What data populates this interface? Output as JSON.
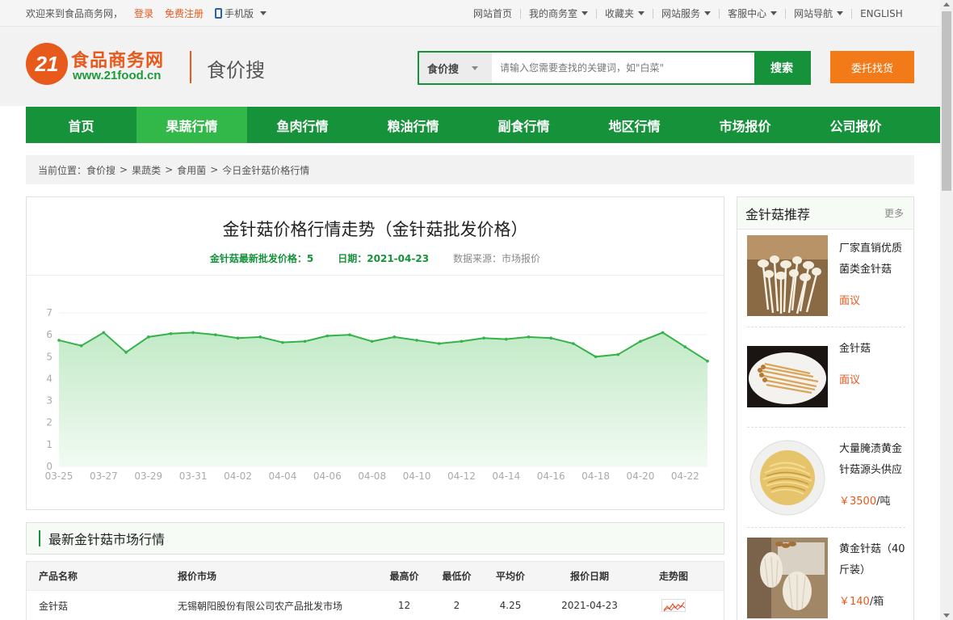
{
  "topbar": {
    "welcome": "欢迎来到食品商务网，",
    "login": "登录",
    "register": "免费注册",
    "mobile": "手机版",
    "links": [
      {
        "label": "网站首页",
        "dropdown": false
      },
      {
        "label": "我的商务室",
        "dropdown": true
      },
      {
        "label": "收藏夹",
        "dropdown": true
      },
      {
        "label": "网站服务",
        "dropdown": true
      },
      {
        "label": "客服中心",
        "dropdown": true
      },
      {
        "label": "网站导航",
        "dropdown": true
      },
      {
        "label": "ENGLISH",
        "dropdown": false
      }
    ]
  },
  "header": {
    "logo_number": "21",
    "logo_cn": "食品商务网",
    "logo_url": "www.21food.cn",
    "subtitle": "食价搜",
    "search_scope": "食价搜",
    "search_placeholder": "请输入您需要查找的关键词，如\"白菜\"",
    "search_button": "搜索",
    "entrust_button": "委托找货"
  },
  "nav": {
    "items": [
      "首页",
      "果蔬行情",
      "鱼肉行情",
      "粮油行情",
      "副食行情",
      "地区行情",
      "市场报价",
      "公司报价"
    ],
    "active_index": 1
  },
  "breadcrumb": {
    "prefix": "当前位置：",
    "items": [
      "食价搜",
      "果蔬类",
      "食用菌",
      "今日金针菇价格行情"
    ],
    "separator": ">"
  },
  "chart_panel": {
    "title": "金针菇价格行情走势（金针菇批发价格）",
    "latest_price": "金针菇最新批发价格：5",
    "date": "日期：2021-04-23",
    "source": "数据来源：市场报价"
  },
  "chart_data": {
    "type": "area",
    "x": [
      "03-25",
      "03-26",
      "03-27",
      "03-28",
      "03-29",
      "03-30",
      "03-31",
      "04-01",
      "04-02",
      "04-03",
      "04-04",
      "04-05",
      "04-06",
      "04-07",
      "04-08",
      "04-09",
      "04-10",
      "04-11",
      "04-12",
      "04-13",
      "04-14",
      "04-15",
      "04-16",
      "04-17",
      "04-18",
      "04-19",
      "04-20",
      "04-21",
      "04-22",
      "04-23"
    ],
    "xticks": [
      "03-25",
      "03-27",
      "03-29",
      "03-31",
      "04-02",
      "04-04",
      "04-06",
      "04-08",
      "04-10",
      "04-12",
      "04-14",
      "04-16",
      "04-18",
      "04-20",
      "04-22"
    ],
    "values": [
      5.75,
      5.5,
      6.1,
      5.2,
      5.9,
      6.05,
      6.1,
      6.0,
      5.85,
      5.9,
      5.65,
      5.7,
      5.95,
      6.0,
      5.7,
      5.9,
      5.75,
      5.6,
      5.7,
      5.85,
      5.8,
      5.9,
      5.85,
      5.6,
      5.0,
      5.1,
      5.7,
      6.1,
      5.45,
      4.8
    ],
    "ylim": [
      0,
      7
    ],
    "yticks": [
      0,
      1,
      2,
      3,
      4,
      5,
      6,
      7
    ],
    "grid": true,
    "line_color": "#34b34a",
    "fill_color": "#cdeecf"
  },
  "market": {
    "title": "最新金针菇市场行情",
    "columns": [
      "产品名称",
      "报价市场",
      "最高价",
      "最低价",
      "平均价",
      "报价日期",
      "走势图"
    ],
    "rows": [
      [
        "金针菇",
        "无锡朝阳股份有限公司农产品批发市场",
        "12",
        "2",
        "4.25",
        "2021-04-23"
      ]
    ]
  },
  "sidebar": {
    "title": "金针菇推荐",
    "more": "更多",
    "items": [
      {
        "name": "厂家直销优质菌类金针菇",
        "price": "面议",
        "unit": ""
      },
      {
        "name": "金针菇",
        "price": "面议",
        "unit": ""
      },
      {
        "name": "大量腌渍黄金针菇源头供应",
        "price": "￥3500",
        "unit": "/吨"
      },
      {
        "name": "黄金针菇（40斤装）",
        "price": "￥140",
        "unit": "/箱"
      }
    ]
  },
  "colors": {
    "green": "#16923b",
    "green_active": "#32b749",
    "orange": "#e8591c",
    "entrust": "#f27a18"
  }
}
